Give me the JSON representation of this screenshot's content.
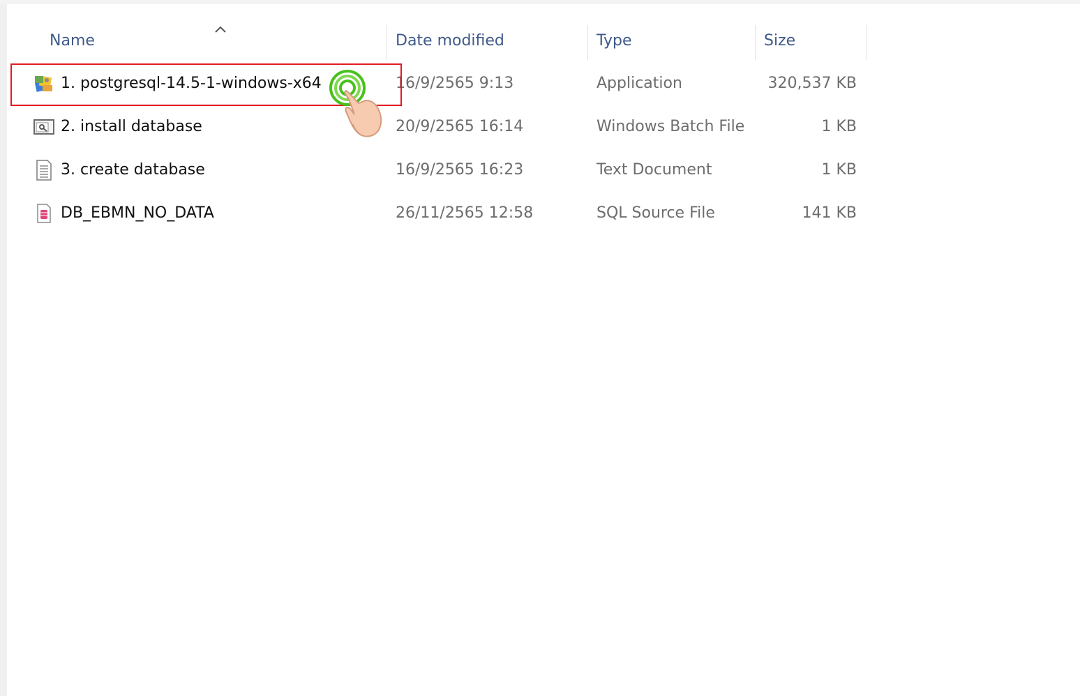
{
  "columns": {
    "name": "Name",
    "date_modified": "Date modified",
    "type": "Type",
    "size": "Size"
  },
  "files": [
    {
      "name": "1. postgresql-14.5-1-windows-x64",
      "date": "16/9/2565 9:13",
      "type": "Application",
      "size": "320,537 KB",
      "icon": "installer-icon"
    },
    {
      "name": "2. install database",
      "date": "20/9/2565 16:14",
      "type": "Windows Batch File",
      "size": "1 KB",
      "icon": "batch-file-icon"
    },
    {
      "name": "3. create database",
      "date": "16/9/2565 16:23",
      "type": "Text Document",
      "size": "1 KB",
      "icon": "text-document-icon"
    },
    {
      "name": "DB_EBMN_NO_DATA",
      "date": "26/11/2565 12:58",
      "type": "SQL Source File",
      "size": "141 KB",
      "icon": "sql-file-icon"
    }
  ],
  "colors": {
    "highlight": "#e21b22",
    "click_indicator": "#49c11d",
    "header_text": "#3f5a8a"
  }
}
